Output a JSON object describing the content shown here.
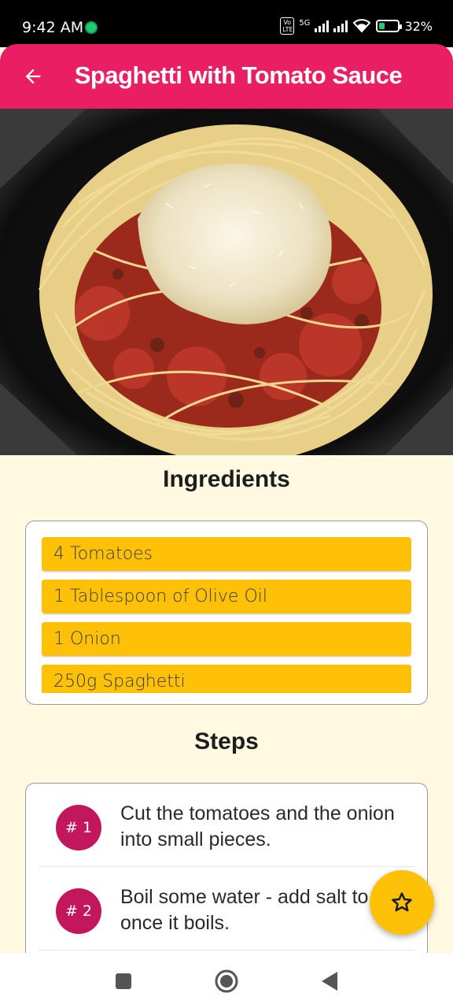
{
  "status_bar": {
    "time": "9:42 AM",
    "network": "5G",
    "volte": "Vo LTE",
    "battery": "32%",
    "battery_level": 0.32
  },
  "app_bar": {
    "title": "Spaghetti with Tomato Sauce",
    "back_icon": "arrow-back-icon"
  },
  "ingredients": {
    "heading": "Ingredients",
    "items": [
      "4 Tomatoes",
      "1 Tablespoon of Olive Oil",
      "1 Onion",
      "250g Spaghetti"
    ]
  },
  "steps": {
    "heading": "Steps",
    "items": [
      {
        "number": "# 1",
        "text": "Cut the tomatoes and the onion into small pieces."
      },
      {
        "number": "# 2",
        "text": "Boil some water - add salt to it once it boils."
      }
    ]
  },
  "fab": {
    "icon": "star-outline-icon"
  },
  "nav_bar": {
    "icons": [
      "recents-square-icon",
      "home-circle-icon",
      "back-triangle-icon"
    ]
  },
  "colors": {
    "primary": "#e91e63",
    "accent": "#ffc107",
    "step_badge": "#c2185b",
    "background": "#fff9e1"
  }
}
